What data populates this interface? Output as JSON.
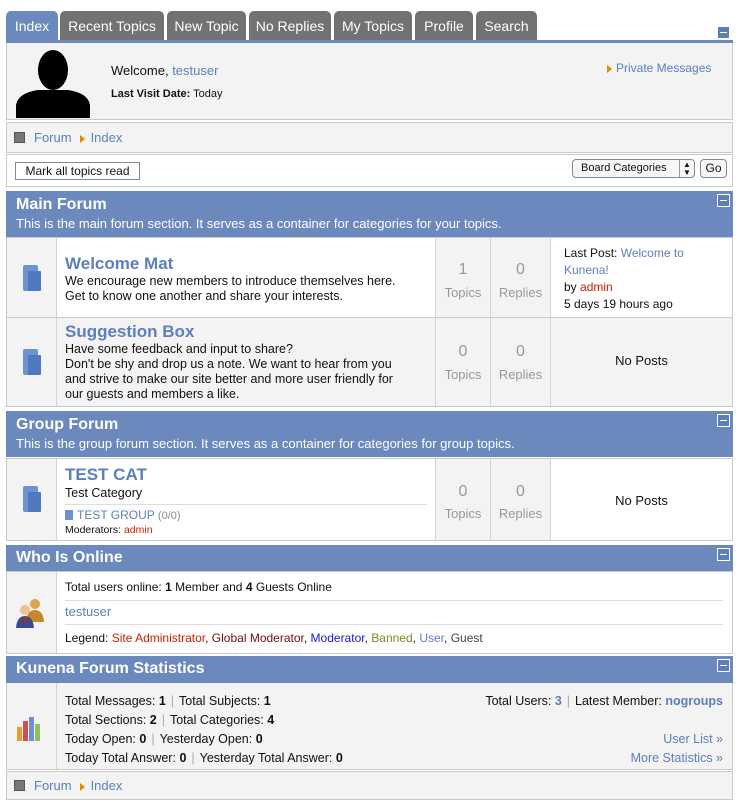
{
  "tabs": [
    "Index",
    "Recent Topics",
    "New Topic",
    "No Replies",
    "My Topics",
    "Profile",
    "Search"
  ],
  "profile": {
    "welcome": "Welcome,",
    "username": "testuser",
    "last_visit_label": "Last Visit Date:",
    "last_visit_value": "Today",
    "private_messages": "Private Messages"
  },
  "breadcrumb": {
    "forum": "Forum",
    "index": "Index"
  },
  "toolbar": {
    "mark_read": "Mark all topics read",
    "select_value": "Board Categories",
    "go": "Go"
  },
  "sections": [
    {
      "title": "Main Forum",
      "description": "This is the main forum section. It serves as a container for categories for your topics.",
      "forums": [
        {
          "name": "Welcome Mat",
          "desc": [
            "We encourage new members to introduce themselves here.",
            "Get to know one another and share your interests."
          ],
          "topics": "1",
          "topics_label": "Topics",
          "replies": "0",
          "replies_label": "Replies",
          "last_post_label": "Last Post:",
          "last_post_title": "Welcome to",
          "last_post_title2": "Kunena!",
          "by": "by",
          "author": "admin",
          "time": "5 days 19 hours ago"
        },
        {
          "name": "Suggestion Box",
          "desc": [
            "Have some feedback and input to share?",
            "Don't be shy and drop us a note. We want to hear from you",
            "and strive to make our site better and more user friendly for",
            "our guests and members a like."
          ],
          "topics": "0",
          "topics_label": "Topics",
          "replies": "0",
          "replies_label": "Replies",
          "no_posts": "No Posts"
        }
      ]
    },
    {
      "title": "Group Forum",
      "description": "This is the group forum section. It serves as a container for categories for group topics.",
      "forums": [
        {
          "name": "TEST CAT",
          "desc": [
            "Test Category"
          ],
          "subforum": "TEST GROUP",
          "subforum_count": "(0/0)",
          "moderators_label": "Moderators:",
          "moderator": "admin",
          "topics": "0",
          "topics_label": "Topics",
          "replies": "0",
          "replies_label": "Replies",
          "no_posts": "No Posts"
        }
      ]
    }
  ],
  "online": {
    "title": "Who Is Online",
    "total_label": "Total users online:",
    "members": "1",
    "member_text": "Member and",
    "guests": "4",
    "guest_text": "Guests Online",
    "user": "testuser",
    "legend_label": "Legend:",
    "legend": [
      {
        "text": "Site Administrator",
        "color": "#cc2200"
      },
      {
        "text": "Global Moderator",
        "color": "#7a0b0b"
      },
      {
        "text": "Moderator",
        "color": "#1a1acc"
      },
      {
        "text": "Banned",
        "color": "#888822"
      },
      {
        "text": "User",
        "color": "#5b7fc0"
      },
      {
        "text": "Guest",
        "color": "#444444"
      }
    ]
  },
  "stats": {
    "title": "Kunena Forum Statistics",
    "total_messages_label": "Total Messages:",
    "total_messages": "1",
    "total_subjects_label": "Total Subjects:",
    "total_subjects": "1",
    "total_sections_label": "Total Sections:",
    "total_sections": "2",
    "total_categories_label": "Total Categories:",
    "total_categories": "4",
    "today_open_label": "Today Open:",
    "today_open": "0",
    "yesterday_open_label": "Yesterday Open:",
    "yesterday_open": "0",
    "today_answer_label": "Today Total Answer:",
    "today_answer": "0",
    "yesterday_answer_label": "Yesterday Total Answer:",
    "yesterday_answer": "0",
    "total_users_label": "Total Users:",
    "total_users": "3",
    "latest_member_label": "Latest Member:",
    "latest_member": "nogroups",
    "user_list": "User List »",
    "more_stats": "More Statistics »"
  },
  "colors": {
    "accent": "#6b89bd",
    "link": "#5b7fc0",
    "tab": "#727272"
  }
}
